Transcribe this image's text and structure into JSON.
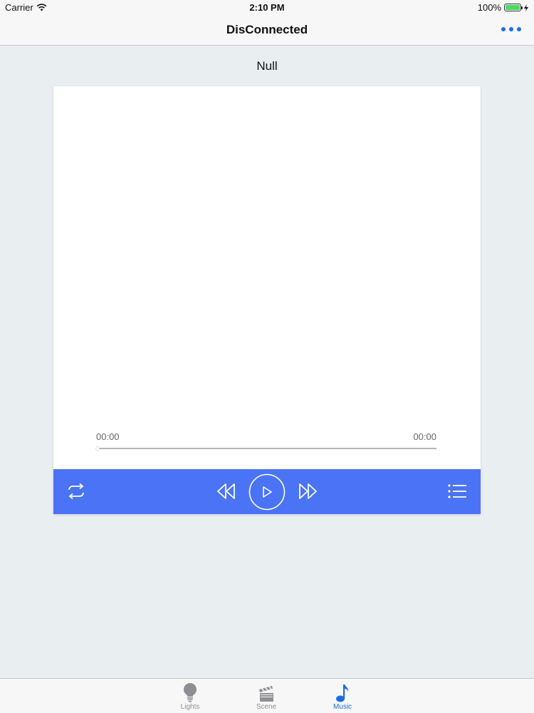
{
  "status_bar": {
    "carrier": "Carrier",
    "time": "2:10 PM",
    "battery_percent": "100%",
    "battery_level": 1.0
  },
  "nav": {
    "title": "DisConnected",
    "more_icon": "more-dots-icon"
  },
  "player": {
    "track_title": "Null",
    "elapsed_time": "00:00",
    "total_time": "00:00",
    "progress": 0,
    "controls": [
      "repeat-icon",
      "rewind-icon",
      "play-icon",
      "fast-forward-icon",
      "playlist-icon"
    ]
  },
  "tab_bar": {
    "tabs": [
      {
        "label": "Lights",
        "icon": "lightbulb-icon",
        "active": false
      },
      {
        "label": "Scene",
        "icon": "clapperboard-icon",
        "active": false
      },
      {
        "label": "Music",
        "icon": "music-note-icon",
        "active": true
      }
    ]
  },
  "colors": {
    "accent": "#1a6fe0",
    "control_bar": "#4a74f5",
    "background": "#e9eef0",
    "battery_fill": "#4cd964"
  }
}
